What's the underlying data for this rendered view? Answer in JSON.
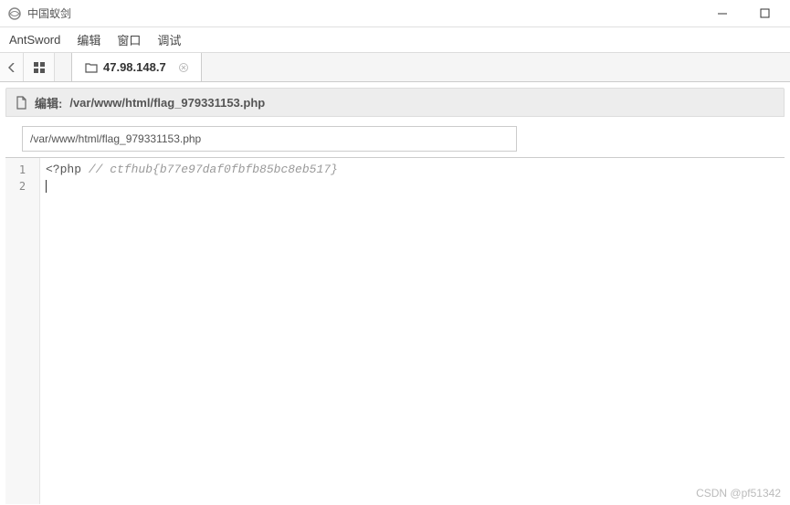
{
  "window": {
    "title": "中国蚁剑"
  },
  "menu": {
    "items": [
      "AntSword",
      "编辑",
      "窗口",
      "调试"
    ]
  },
  "tabs": {
    "active_label": "47.98.148.7"
  },
  "editor_header": {
    "prefix": "编辑:",
    "path": "/var/www/html/flag_979331153.php"
  },
  "path_input": {
    "value": "/var/www/html/flag_979331153.php"
  },
  "code": {
    "lines": [
      {
        "num": "1",
        "segments": [
          {
            "cls": "tok-tag",
            "text": "<?php "
          },
          {
            "cls": "tok-comment",
            "text": "// ctfhub{b77e97daf0fbfb85bc8eb517}"
          }
        ]
      },
      {
        "num": "2",
        "segments": []
      }
    ]
  },
  "watermark": "CSDN @pf51342"
}
